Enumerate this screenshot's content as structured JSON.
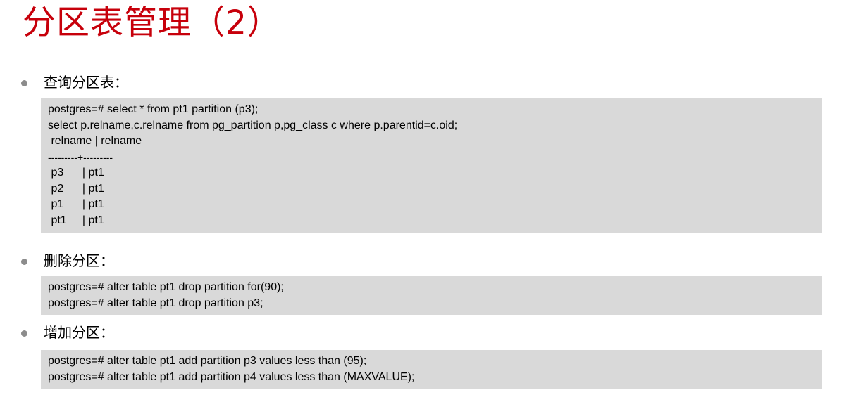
{
  "title": "分区表管理（2）",
  "sections": [
    {
      "heading": "查询分区表：",
      "code_lines": [
        "postgres=# select * from pt1 partition (p3);",
        "select p.relname,c.relname from pg_partition p,pg_class c where p.parentid=c.oid;",
        " relname | relname",
        "---------+---------",
        " p3      | pt1",
        " p2      | pt1",
        " p1      | pt1",
        " pt1     | pt1"
      ]
    },
    {
      "heading": "删除分区：",
      "code_lines": [
        "postgres=# alter table pt1 drop partition for(90);",
        "postgres=# alter table pt1 drop partition p3;"
      ]
    },
    {
      "heading": "增加分区：",
      "code_lines": [
        "postgres=# alter table pt1 add partition p3 values less than (95);",
        "postgres=# alter table pt1 add partition p4 values less than (MAXVALUE);"
      ]
    }
  ],
  "colors": {
    "title": "#c7000b",
    "code_background": "#d9d9d9",
    "bullet": "#8c8c8c"
  }
}
